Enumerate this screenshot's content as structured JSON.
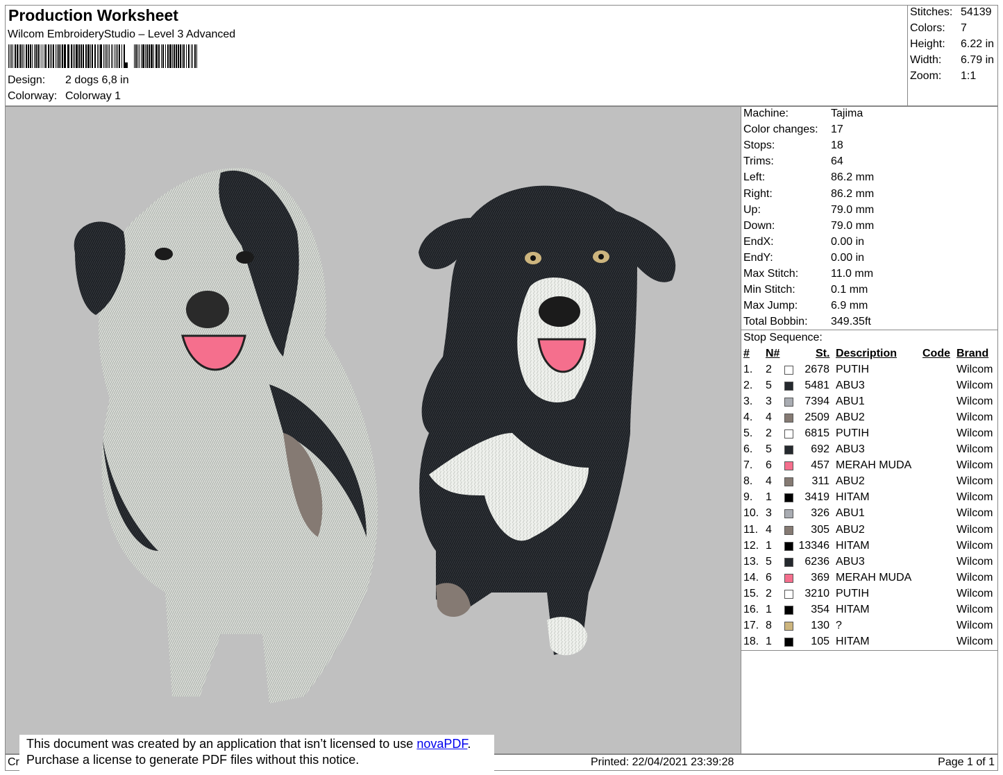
{
  "header": {
    "title": "Production Worksheet",
    "subtitle": "Wilcom EmbroideryStudio – Level 3 Advanced",
    "design_label": "Design:",
    "design_value": "2 dogs 6,8 in",
    "colorway_label": "Colorway:",
    "colorway_value": "Colorway 1"
  },
  "stats": [
    {
      "label": "Stitches:",
      "value": "54139"
    },
    {
      "label": "Colors:",
      "value": "7"
    },
    {
      "label": "Height:",
      "value": "6.22 in"
    },
    {
      "label": "Width:",
      "value": "6.79 in"
    },
    {
      "label": "Zoom:",
      "value": "1:1"
    }
  ],
  "machine_info": [
    {
      "label": "Machine:",
      "value": "Tajima"
    },
    {
      "label": "Color changes:",
      "value": "17"
    },
    {
      "label": "Stops:",
      "value": "18"
    },
    {
      "label": "Trims:",
      "value": "64"
    },
    {
      "label": "Left:",
      "value": "86.2 mm"
    },
    {
      "label": "Right:",
      "value": "86.2 mm"
    },
    {
      "label": "Up:",
      "value": "79.0 mm"
    },
    {
      "label": "Down:",
      "value": "79.0 mm"
    },
    {
      "label": "EndX:",
      "value": "0.00 in"
    },
    {
      "label": "EndY:",
      "value": "0.00 in"
    },
    {
      "label": "Max Stitch:",
      "value": "11.0 mm"
    },
    {
      "label": "Min Stitch:",
      "value": "0.1 mm"
    },
    {
      "label": "Max Jump:",
      "value": "6.9 mm"
    },
    {
      "label": "Total Bobbin:",
      "value": "349.35ft"
    }
  ],
  "stop_sequence": {
    "title": "Stop Sequence:",
    "headers": {
      "num": "#",
      "n": "N#",
      "st": "St.",
      "desc": "Description",
      "code": "Code",
      "brand": "Brand"
    },
    "rows": [
      {
        "num": "1.",
        "n": "2",
        "color": "#ffffff",
        "st": "2678",
        "desc": "PUTIH",
        "brand": "Wilcom"
      },
      {
        "num": "2.",
        "n": "5",
        "color": "#25292e",
        "st": "5481",
        "desc": "ABU3",
        "brand": "Wilcom"
      },
      {
        "num": "3.",
        "n": "3",
        "color": "#a9acb2",
        "st": "7394",
        "desc": "ABU1",
        "brand": "Wilcom"
      },
      {
        "num": "4.",
        "n": "4",
        "color": "#857a73",
        "st": "2509",
        "desc": "ABU2",
        "brand": "Wilcom"
      },
      {
        "num": "5.",
        "n": "2",
        "color": "#ffffff",
        "st": "6815",
        "desc": "PUTIH",
        "brand": "Wilcom"
      },
      {
        "num": "6.",
        "n": "5",
        "color": "#25292e",
        "st": "692",
        "desc": "ABU3",
        "brand": "Wilcom"
      },
      {
        "num": "7.",
        "n": "6",
        "color": "#f56f8d",
        "st": "457",
        "desc": "MERAH MUDA",
        "brand": "Wilcom"
      },
      {
        "num": "8.",
        "n": "4",
        "color": "#857a73",
        "st": "311",
        "desc": "ABU2",
        "brand": "Wilcom"
      },
      {
        "num": "9.",
        "n": "1",
        "color": "#000000",
        "st": "3419",
        "desc": "HITAM",
        "brand": "Wilcom"
      },
      {
        "num": "10.",
        "n": "3",
        "color": "#a9acb2",
        "st": "326",
        "desc": "ABU1",
        "brand": "Wilcom"
      },
      {
        "num": "11.",
        "n": "4",
        "color": "#857a73",
        "st": "305",
        "desc": "ABU2",
        "brand": "Wilcom"
      },
      {
        "num": "12.",
        "n": "1",
        "color": "#000000",
        "st": "13346",
        "desc": "HITAM",
        "brand": "Wilcom"
      },
      {
        "num": "13.",
        "n": "5",
        "color": "#25292e",
        "st": "6236",
        "desc": "ABU3",
        "brand": "Wilcom"
      },
      {
        "num": "14.",
        "n": "6",
        "color": "#f56f8d",
        "st": "369",
        "desc": "MERAH MUDA",
        "brand": "Wilcom"
      },
      {
        "num": "15.",
        "n": "2",
        "color": "#ffffff",
        "st": "3210",
        "desc": "PUTIH",
        "brand": "Wilcom"
      },
      {
        "num": "16.",
        "n": "1",
        "color": "#000000",
        "st": "354",
        "desc": "HITAM",
        "brand": "Wilcom"
      },
      {
        "num": "17.",
        "n": "8",
        "color": "#cdb57e",
        "st": "130",
        "desc": "?",
        "brand": "Wilcom"
      },
      {
        "num": "18.",
        "n": "1",
        "color": "#000000",
        "st": "105",
        "desc": "HITAM",
        "brand": "Wilcom"
      }
    ]
  },
  "footer": {
    "left_text": "Cr",
    "printed": "Printed: 22/04/2021 23:39:28",
    "page": "Page 1 of 1"
  },
  "notice": {
    "line1_prefix": "This document was created by an application that isn’t licensed to use ",
    "link": "novaPDF",
    "line1_suffix": ".",
    "line2": "Purchase a license to generate PDF files without this notice."
  }
}
